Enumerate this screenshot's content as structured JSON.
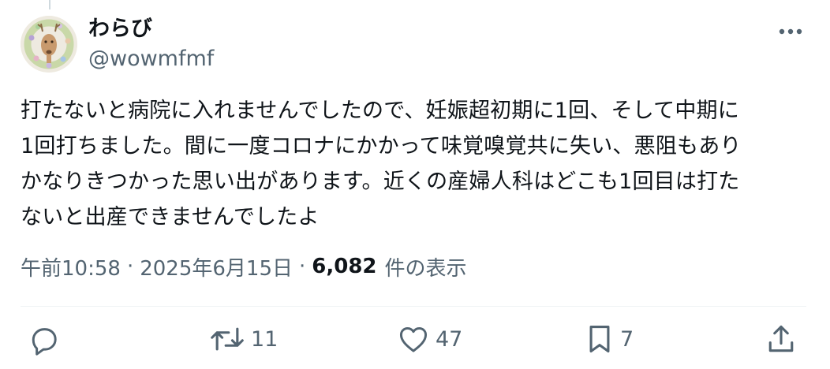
{
  "author": {
    "display_name": "わらび",
    "handle": "@wowmfmf"
  },
  "tweet": {
    "lines": [
      "打たないと病院に入れませんでしたので、妊娠超初期に1回、そして中期に",
      "1回打ちました。間に一度コロナにかかって味覚嗅覚共に失い、悪阻もあり",
      "かなりきつかった思い出があります。近くの産婦人科はどこも1回目は打た",
      "ないと出産できませんでしたよ"
    ]
  },
  "meta": {
    "time": "午前10:58",
    "separator": "·",
    "date": "2025年6月15日",
    "views_count": "6,082",
    "views_label": "件の表示"
  },
  "actions": {
    "reply_count": "",
    "retweet_count": "11",
    "like_count": "47",
    "bookmark_count": "7"
  },
  "icons": {
    "more": "more-horizontal-icon",
    "reply": "reply-icon",
    "retweet": "retweet-icon",
    "like": "heart-icon",
    "bookmark": "bookmark-icon",
    "share": "share-icon"
  },
  "colors": {
    "text_primary": "#0f1419",
    "text_secondary": "#536471",
    "divider": "#eff3f4"
  }
}
